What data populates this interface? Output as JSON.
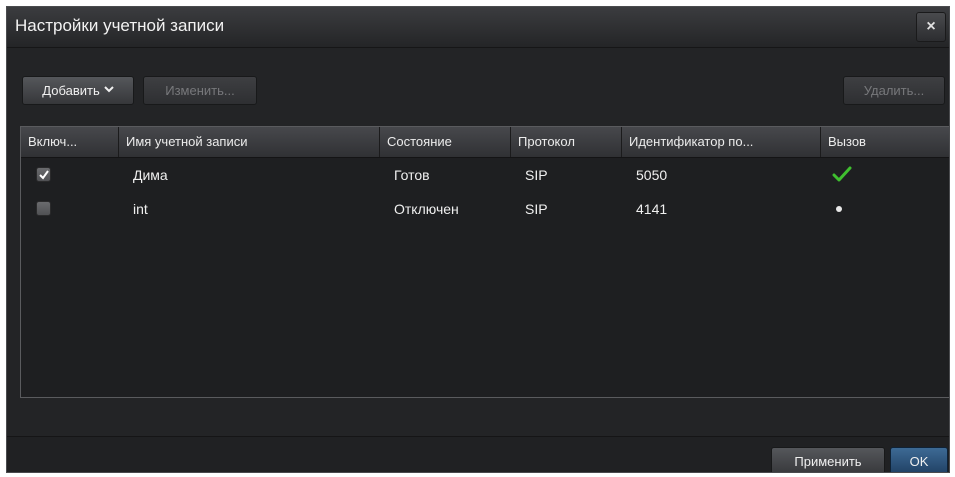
{
  "window": {
    "title": "Настройки учетной записи",
    "close_label": "×"
  },
  "toolbar": {
    "add_label": "Добавить",
    "edit_label": "Изменить...",
    "delete_label": "Удалить..."
  },
  "chart_data": {
    "type": "table",
    "columns": [
      "Включ...",
      "Имя учетной записи",
      "Состояние",
      "Протокол",
      "Идентификатор по...",
      "Вызов"
    ],
    "rows": [
      {
        "enabled": true,
        "name": "Дима",
        "status": "Готов",
        "protocol": "SIP",
        "id": "5050",
        "call": "check"
      },
      {
        "enabled": false,
        "name": "int",
        "status": "Отключен",
        "protocol": "SIP",
        "id": "4141",
        "call": "dot"
      }
    ]
  },
  "footer": {
    "apply_label": "Применить",
    "ok_label": "OK"
  },
  "colors": {
    "accent_ok": "#2b527a",
    "check_green": "#3fbf2f",
    "window_bg": "#232426"
  },
  "icons": {
    "close": "close-icon",
    "chevron": "chevron-down-icon",
    "call_ready": "check-icon",
    "call_idle": "dot-icon"
  }
}
